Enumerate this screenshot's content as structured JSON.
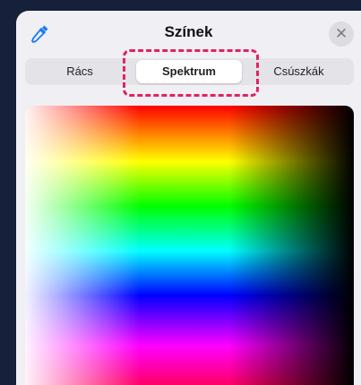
{
  "header": {
    "title": "Színek",
    "eyedropper_icon": "eyedropper-icon",
    "close_icon": "close-icon",
    "close_glyph": "✕"
  },
  "tabs": [
    {
      "label": "Rács",
      "selected": false
    },
    {
      "label": "Spektrum",
      "selected": true
    },
    {
      "label": "Csúszkák",
      "selected": false
    }
  ],
  "colors": {
    "panel_background": "#efeff4",
    "accent_eyedropper": "#1c7cf4",
    "annotation_highlight": "#e0245e"
  }
}
